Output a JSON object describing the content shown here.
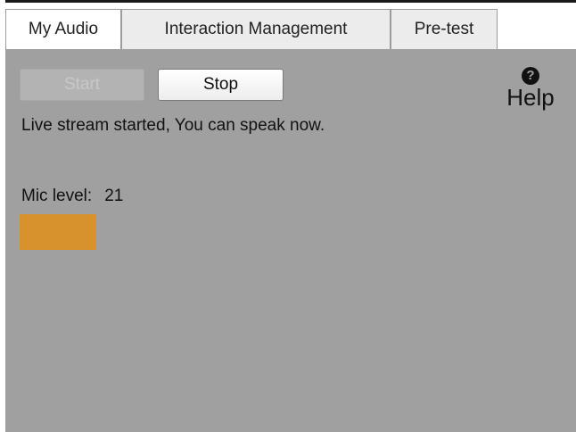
{
  "tabs": [
    {
      "label": "My Audio",
      "active": true
    },
    {
      "label": "Interaction Management",
      "active": false
    },
    {
      "label": "Pre-test",
      "active": false
    }
  ],
  "controls": {
    "start_label": "Start",
    "stop_label": "Stop"
  },
  "status_text": "Live stream started, You can speak now.",
  "help": {
    "icon": "?",
    "label": "Help"
  },
  "mic": {
    "label": "Mic level:",
    "value": "21",
    "bar_color": "#d8922d"
  },
  "colors": {
    "panel": "#a0a0a0",
    "accent": "#d8922d"
  }
}
